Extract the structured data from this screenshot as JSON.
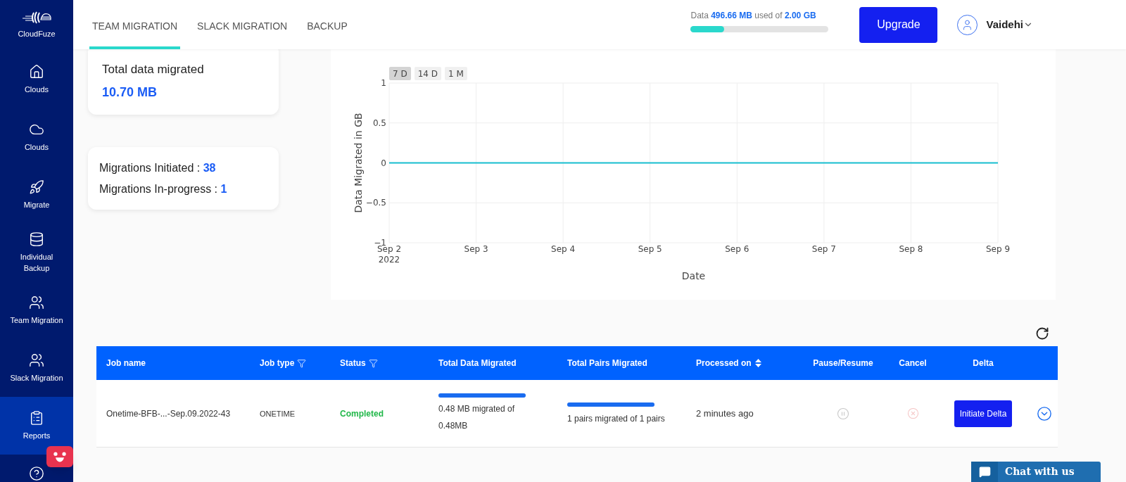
{
  "sidebar": {
    "brand": "CloudFuze",
    "items": [
      {
        "label": "Clouds",
        "selected": false
      },
      {
        "label": "Clouds",
        "selected": false
      },
      {
        "label": "Migrate",
        "selected": false
      },
      {
        "label": "Individual Backup",
        "selected": false
      },
      {
        "label": "Team Migration",
        "selected": false
      },
      {
        "label": "Slack Migration",
        "selected": false
      },
      {
        "label": "Reports",
        "selected": true
      }
    ]
  },
  "tabs": [
    {
      "label": "TEAM MIGRATION",
      "selected": true
    },
    {
      "label": "SLACK MIGRATION",
      "selected": false
    },
    {
      "label": "BACKUP",
      "selected": false
    }
  ],
  "storage": {
    "prefix": "Data",
    "used": "496.66 MB",
    "middle": "used of",
    "total": "2.00 GB",
    "level": 0.24
  },
  "upgrade_button": "Upgrade",
  "user": {
    "name": "Vaidehi"
  },
  "summary": {
    "total_label": "Total data migrated",
    "total_value": "10.70 MB",
    "initiated_label": "Migrations Initiated :",
    "initiated_value": "38",
    "inprogress_label": "Migrations In-progress :",
    "inprogress_value": "1"
  },
  "chart": {
    "range_buttons": [
      {
        "label": "7 D",
        "selected": true
      },
      {
        "label": "14 D",
        "selected": false
      },
      {
        "label": "1 M",
        "selected": false
      }
    ],
    "year_label": "2022",
    "chart_data": {
      "type": "line",
      "xlabel": "Date",
      "ylabel": "Data Migrated in GB",
      "categories": [
        "Sep 2",
        "Sep 3",
        "Sep 4",
        "Sep 5",
        "Sep 6",
        "Sep 7",
        "Sep 8",
        "Sep 9"
      ],
      "grid": true,
      "series": [
        {
          "color": "#17becf",
          "values": [
            0,
            0,
            0,
            0,
            0,
            0,
            0,
            0
          ]
        }
      ],
      "ylim": [
        -1,
        1
      ],
      "yticks": [
        {
          "value": -1,
          "label": "−1"
        },
        {
          "value": -0.5,
          "label": "−0.5"
        },
        0,
        0.5,
        1
      ]
    }
  },
  "table": {
    "columns": [
      {
        "label": "Job name",
        "kind": "plain"
      },
      {
        "label": "Job type",
        "kind": "filter"
      },
      {
        "label": "Status",
        "kind": "filter"
      },
      {
        "label": "Total Data Migrated",
        "kind": "plain"
      },
      {
        "label": "Total Pairs Migrated",
        "kind": "plain"
      },
      {
        "label": "Processed on",
        "kind": "sort"
      },
      {
        "label": "Pause/Resume",
        "kind": "plain"
      },
      {
        "label": "Cancel",
        "kind": "plain"
      },
      {
        "label": "Delta",
        "kind": "plain"
      }
    ],
    "rows": [
      {
        "job_name": "Onetime-BFB-...-Sep.09.2022-43",
        "job_type": "ONETIME",
        "status": "Completed",
        "data_progress": {
          "level": 1,
          "text": "0.48 MB migrated of 0.48MB"
        },
        "pairs_progress": {
          "level": 1,
          "text": "1 pairs migrated of 1 pairs"
        },
        "processed_on": "2 minutes ago",
        "pause_disabled": true,
        "cancel_disabled": true,
        "delta_button": "Initiate Delta"
      }
    ]
  },
  "chat_button": "Chat with us"
}
